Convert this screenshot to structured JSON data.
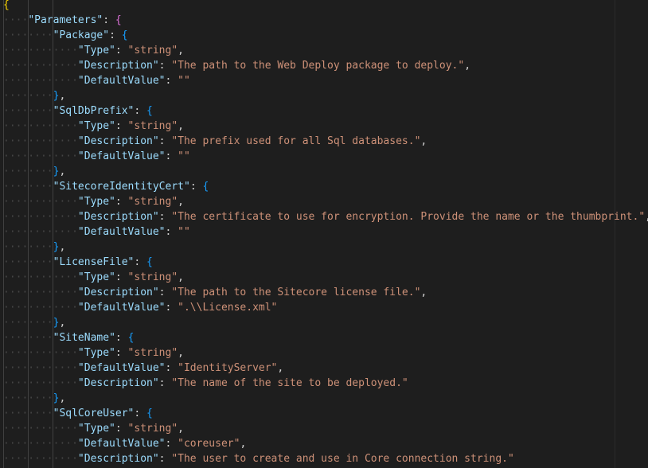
{
  "editor": {
    "lines": [
      [
        {
          "t": "{",
          "c": "brace-1"
        }
      ],
      [
        {
          "t": "····",
          "c": "ws"
        },
        {
          "t": "\"Parameters\"",
          "c": "key"
        },
        {
          "t": ": ",
          "c": "punc"
        },
        {
          "t": "{",
          "c": "brace-2"
        }
      ],
      [
        {
          "t": "········",
          "c": "ws"
        },
        {
          "t": "\"Package\"",
          "c": "key"
        },
        {
          "t": ": ",
          "c": "punc"
        },
        {
          "t": "{",
          "c": "brace-3"
        }
      ],
      [
        {
          "t": "············",
          "c": "ws"
        },
        {
          "t": "\"Type\"",
          "c": "key"
        },
        {
          "t": ": ",
          "c": "punc"
        },
        {
          "t": "\"string\"",
          "c": "str"
        },
        {
          "t": ",",
          "c": "punc"
        }
      ],
      [
        {
          "t": "············",
          "c": "ws"
        },
        {
          "t": "\"Description\"",
          "c": "key"
        },
        {
          "t": ": ",
          "c": "punc"
        },
        {
          "t": "\"The path to the Web Deploy package to deploy.\"",
          "c": "str"
        },
        {
          "t": ",",
          "c": "punc"
        }
      ],
      [
        {
          "t": "············",
          "c": "ws"
        },
        {
          "t": "\"DefaultValue\"",
          "c": "key"
        },
        {
          "t": ": ",
          "c": "punc"
        },
        {
          "t": "\"\"",
          "c": "str"
        }
      ],
      [
        {
          "t": "········",
          "c": "ws"
        },
        {
          "t": "}",
          "c": "brace-3"
        },
        {
          "t": ",",
          "c": "punc"
        }
      ],
      [
        {
          "t": "········",
          "c": "ws"
        },
        {
          "t": "\"SqlDbPrefix\"",
          "c": "key"
        },
        {
          "t": ": ",
          "c": "punc"
        },
        {
          "t": "{",
          "c": "brace-3"
        }
      ],
      [
        {
          "t": "············",
          "c": "ws"
        },
        {
          "t": "\"Type\"",
          "c": "key"
        },
        {
          "t": ": ",
          "c": "punc"
        },
        {
          "t": "\"string\"",
          "c": "str"
        },
        {
          "t": ",",
          "c": "punc"
        }
      ],
      [
        {
          "t": "············",
          "c": "ws"
        },
        {
          "t": "\"Description\"",
          "c": "key"
        },
        {
          "t": ": ",
          "c": "punc"
        },
        {
          "t": "\"The prefix used for all Sql databases.\"",
          "c": "str"
        },
        {
          "t": ",",
          "c": "punc"
        }
      ],
      [
        {
          "t": "············",
          "c": "ws"
        },
        {
          "t": "\"DefaultValue\"",
          "c": "key"
        },
        {
          "t": ": ",
          "c": "punc"
        },
        {
          "t": "\"\"",
          "c": "str"
        }
      ],
      [
        {
          "t": "········",
          "c": "ws"
        },
        {
          "t": "}",
          "c": "brace-3"
        },
        {
          "t": ",",
          "c": "punc"
        }
      ],
      [
        {
          "t": "········",
          "c": "ws"
        },
        {
          "t": "\"SitecoreIdentityCert\"",
          "c": "key"
        },
        {
          "t": ": ",
          "c": "punc"
        },
        {
          "t": "{",
          "c": "brace-3"
        }
      ],
      [
        {
          "t": "············",
          "c": "ws"
        },
        {
          "t": "\"Type\"",
          "c": "key"
        },
        {
          "t": ": ",
          "c": "punc"
        },
        {
          "t": "\"string\"",
          "c": "str"
        },
        {
          "t": ",",
          "c": "punc"
        }
      ],
      [
        {
          "t": "············",
          "c": "ws"
        },
        {
          "t": "\"Description\"",
          "c": "key"
        },
        {
          "t": ": ",
          "c": "punc"
        },
        {
          "t": "\"The certificate to use for encryption. Provide the name or the thumbprint.\"",
          "c": "str"
        },
        {
          "t": ",",
          "c": "punc"
        }
      ],
      [
        {
          "t": "············",
          "c": "ws"
        },
        {
          "t": "\"DefaultValue\"",
          "c": "key"
        },
        {
          "t": ": ",
          "c": "punc"
        },
        {
          "t": "\"\"",
          "c": "str"
        }
      ],
      [
        {
          "t": "········",
          "c": "ws"
        },
        {
          "t": "}",
          "c": "brace-3"
        },
        {
          "t": ",",
          "c": "punc"
        }
      ],
      [
        {
          "t": "········",
          "c": "ws"
        },
        {
          "t": "\"LicenseFile\"",
          "c": "key"
        },
        {
          "t": ": ",
          "c": "punc"
        },
        {
          "t": "{",
          "c": "brace-3"
        }
      ],
      [
        {
          "t": "············",
          "c": "ws"
        },
        {
          "t": "\"Type\"",
          "c": "key"
        },
        {
          "t": ": ",
          "c": "punc"
        },
        {
          "t": "\"string\"",
          "c": "str"
        },
        {
          "t": ",",
          "c": "punc"
        }
      ],
      [
        {
          "t": "············",
          "c": "ws"
        },
        {
          "t": "\"Description\"",
          "c": "key"
        },
        {
          "t": ": ",
          "c": "punc"
        },
        {
          "t": "\"The path to the Sitecore license file.\"",
          "c": "str"
        },
        {
          "t": ",",
          "c": "punc"
        }
      ],
      [
        {
          "t": "············",
          "c": "ws"
        },
        {
          "t": "\"DefaultValue\"",
          "c": "key"
        },
        {
          "t": ": ",
          "c": "punc"
        },
        {
          "t": "\".\\\\License.xml\"",
          "c": "str"
        }
      ],
      [
        {
          "t": "········",
          "c": "ws"
        },
        {
          "t": "}",
          "c": "brace-3"
        },
        {
          "t": ",",
          "c": "punc"
        }
      ],
      [
        {
          "t": "········",
          "c": "ws"
        },
        {
          "t": "\"SiteName\"",
          "c": "key"
        },
        {
          "t": ": ",
          "c": "punc"
        },
        {
          "t": "{",
          "c": "brace-3"
        }
      ],
      [
        {
          "t": "············",
          "c": "ws"
        },
        {
          "t": "\"Type\"",
          "c": "key"
        },
        {
          "t": ": ",
          "c": "punc"
        },
        {
          "t": "\"string\"",
          "c": "str"
        },
        {
          "t": ",",
          "c": "punc"
        }
      ],
      [
        {
          "t": "············",
          "c": "ws"
        },
        {
          "t": "\"DefaultValue\"",
          "c": "key"
        },
        {
          "t": ": ",
          "c": "punc"
        },
        {
          "t": "\"IdentityServer\"",
          "c": "str"
        },
        {
          "t": ",",
          "c": "punc"
        }
      ],
      [
        {
          "t": "············",
          "c": "ws"
        },
        {
          "t": "\"Description\"",
          "c": "key"
        },
        {
          "t": ": ",
          "c": "punc"
        },
        {
          "t": "\"The name of the site to be deployed.\"",
          "c": "str"
        }
      ],
      [
        {
          "t": "········",
          "c": "ws"
        },
        {
          "t": "}",
          "c": "brace-3"
        },
        {
          "t": ",",
          "c": "punc"
        }
      ],
      [
        {
          "t": "········",
          "c": "ws"
        },
        {
          "t": "\"SqlCoreUser\"",
          "c": "key"
        },
        {
          "t": ": ",
          "c": "punc"
        },
        {
          "t": "{",
          "c": "brace-3"
        }
      ],
      [
        {
          "t": "············",
          "c": "ws"
        },
        {
          "t": "\"Type\"",
          "c": "key"
        },
        {
          "t": ": ",
          "c": "punc"
        },
        {
          "t": "\"string\"",
          "c": "str"
        },
        {
          "t": ",",
          "c": "punc"
        }
      ],
      [
        {
          "t": "············",
          "c": "ws"
        },
        {
          "t": "\"DefaultValue\"",
          "c": "key"
        },
        {
          "t": ": ",
          "c": "punc"
        },
        {
          "t": "\"coreuser\"",
          "c": "str"
        },
        {
          "t": ",",
          "c": "punc"
        }
      ],
      [
        {
          "t": "············",
          "c": "ws"
        },
        {
          "t": "\"Description\"",
          "c": "key"
        },
        {
          "t": ": ",
          "c": "punc"
        },
        {
          "t": "\"The user to create and use in Core connection string.\"",
          "c": "str"
        }
      ]
    ]
  },
  "colors": {
    "background": "#1e1e1e",
    "key": "#9cdcfe",
    "string": "#ce9178",
    "punctuation": "#d4d4d4",
    "whitespace_dots": "#454545",
    "brace_level_1": "#ffd700",
    "brace_level_2": "#da70d6",
    "brace_level_3": "#179fff"
  }
}
